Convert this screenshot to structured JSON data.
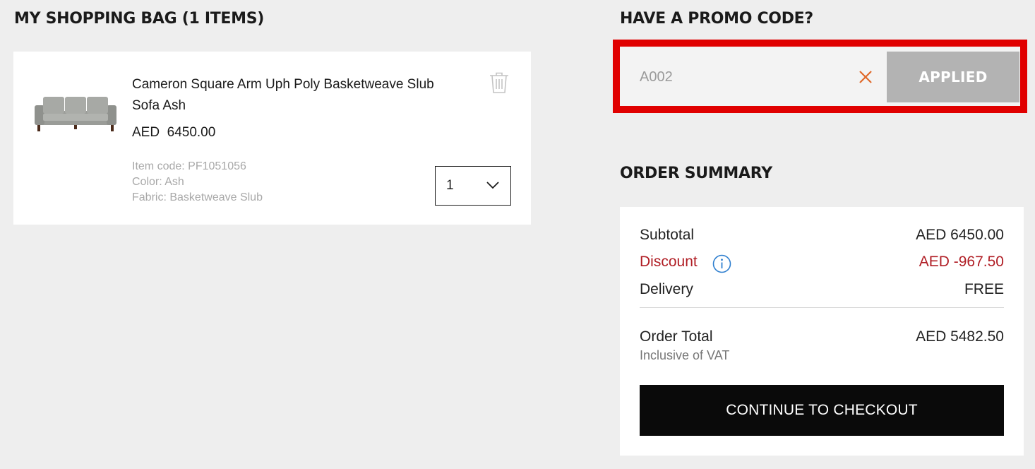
{
  "bag": {
    "title": "MY SHOPPING BAG (1 ITEMS)",
    "item": {
      "name": "Cameron Square Arm Uph Poly Basketweave Slub Sofa Ash",
      "price": "AED  6450.00",
      "item_code": "Item code: PF1051056",
      "color": "Color: Ash",
      "fabric": "Fabric: Basketweave Slub",
      "quantity": "1",
      "image_icon": "sofa-image",
      "delete_icon": "trash-icon"
    }
  },
  "promo": {
    "title": "HAVE A PROMO CODE?",
    "code_value": "A002",
    "clear_icon": "close-icon",
    "button_label": "APPLIED",
    "highlight_color": "#e00000"
  },
  "summary": {
    "title": "ORDER SUMMARY",
    "subtotal_label": "Subtotal",
    "subtotal_value": "AED 6450.00",
    "discount_label": "Discount",
    "discount_value": "AED -967.50",
    "discount_color": "#b01d24",
    "info_icon": "info-icon",
    "delivery_label": "Delivery",
    "delivery_value": "FREE",
    "total_label": "Order Total",
    "total_value": "AED 5482.50",
    "vat_note": "Inclusive of VAT",
    "checkout_label": "CONTINUE TO CHECKOUT"
  }
}
